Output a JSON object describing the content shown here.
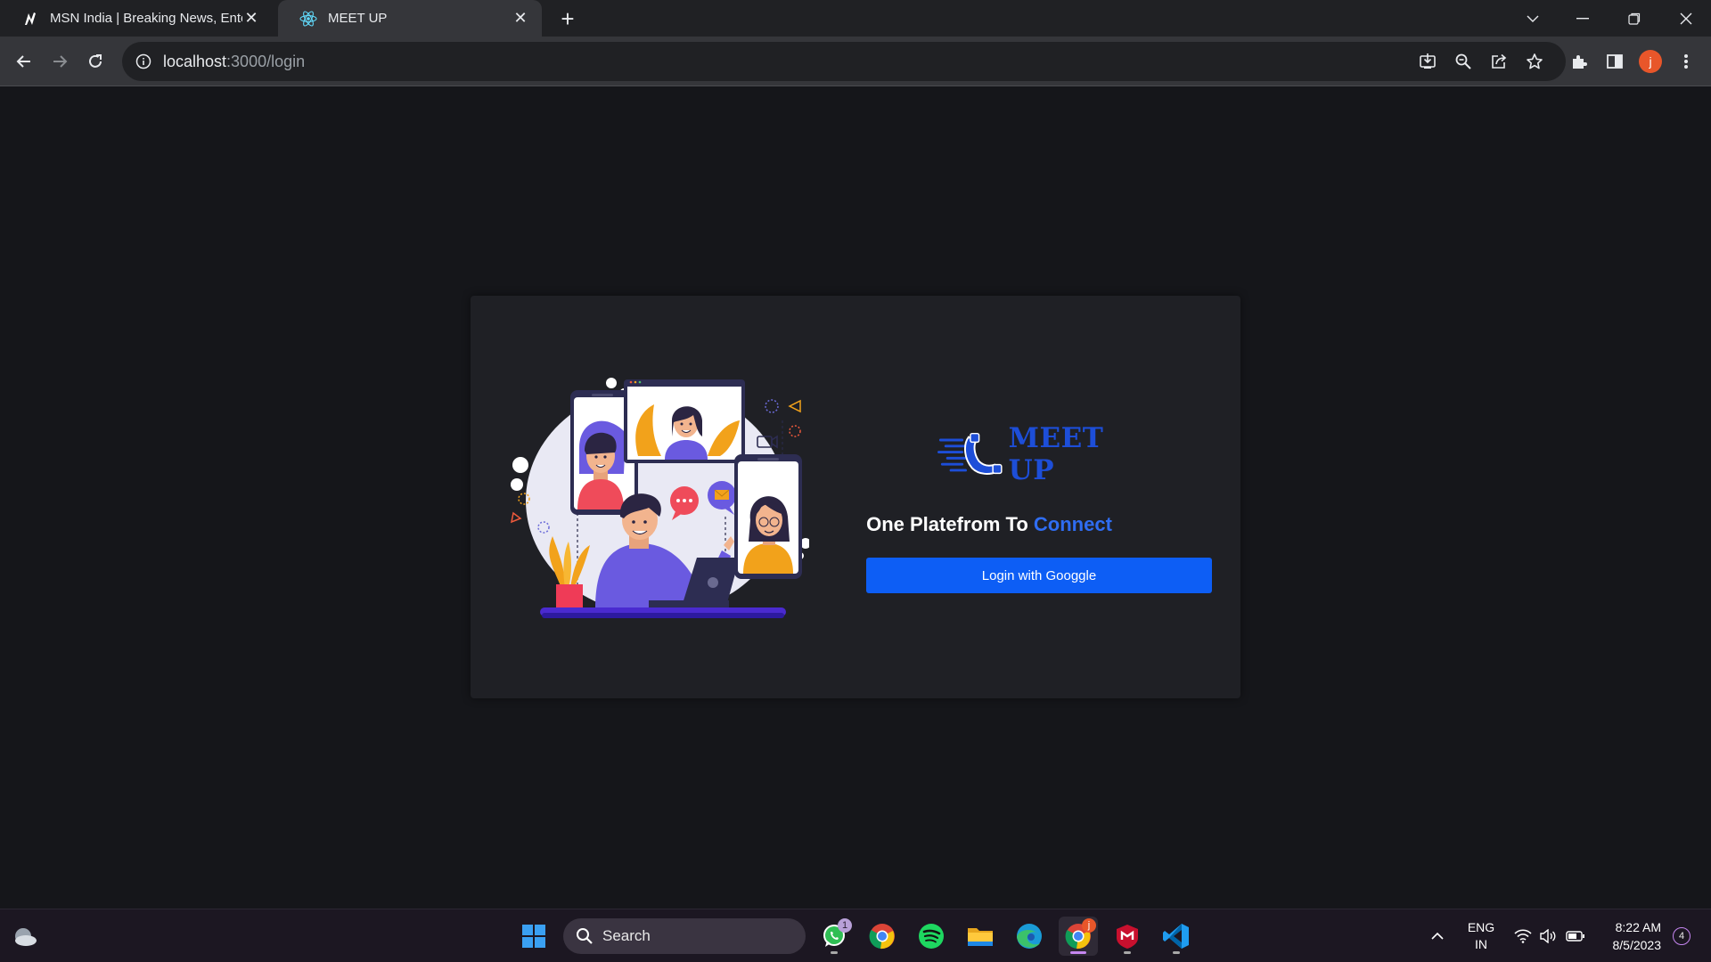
{
  "browser": {
    "tabs": [
      {
        "title": "MSN India | Breaking News, Ente",
        "favicon": "msn-icon",
        "active": false
      },
      {
        "title": "MEET UP",
        "favicon": "react-icon",
        "active": true
      }
    ],
    "new_tab_icon": "plus-icon",
    "window_controls": [
      "chevron-down-icon",
      "minimize-icon",
      "restore-icon",
      "close-icon"
    ],
    "url_host": "localhost",
    "url_path": ":3000/login",
    "profile_initial": "j",
    "toolbar_icons": [
      "install-icon",
      "zoom-icon",
      "share-icon",
      "star-icon",
      "extensions-icon",
      "side-panel-icon",
      "menu-icon"
    ]
  },
  "page": {
    "brand_name": "MEET UP",
    "tagline_prefix": "One Platefrom To ",
    "tagline_accent": "Connect",
    "login_button": "Login with Googgle",
    "colors": {
      "background": "#15161a",
      "card": "#1f2025",
      "accent": "#2f6df2",
      "button": "#0d5ef5",
      "logo": "#1d4ed8"
    }
  },
  "taskbar": {
    "search_placeholder": "Search",
    "apps": [
      {
        "name": "whatsapp-icon",
        "badge": "1"
      },
      {
        "name": "chrome-icon"
      },
      {
        "name": "spotify-icon"
      },
      {
        "name": "file-explorer-icon"
      },
      {
        "name": "edge-icon"
      },
      {
        "name": "chrome-profile-icon",
        "badge": "j",
        "active": true
      },
      {
        "name": "mcafee-icon"
      },
      {
        "name": "vscode-icon"
      }
    ],
    "language": "ENG",
    "region": "IN",
    "time": "8:22 AM",
    "date": "8/5/2023",
    "notification_count": "4"
  }
}
